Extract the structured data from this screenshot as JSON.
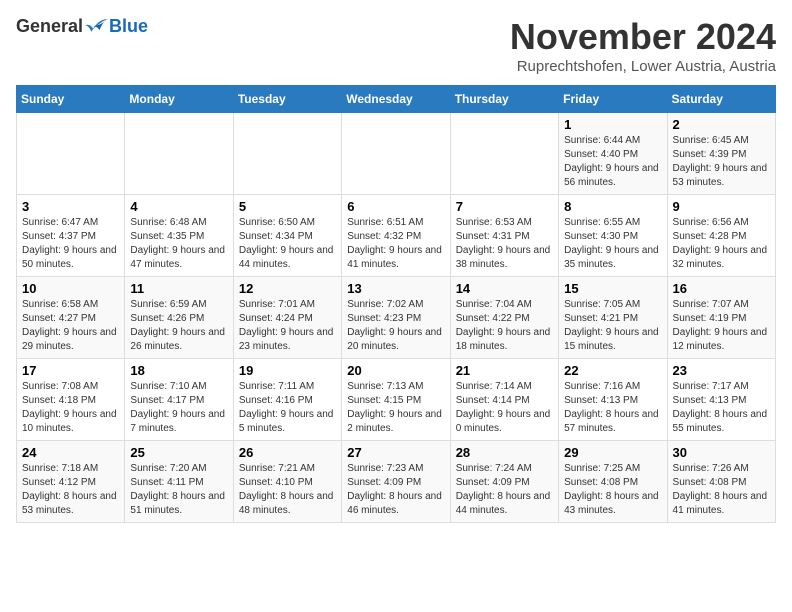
{
  "logo": {
    "general": "General",
    "blue": "Blue"
  },
  "header": {
    "month": "November 2024",
    "location": "Ruprechtshofen, Lower Austria, Austria"
  },
  "weekdays": [
    "Sunday",
    "Monday",
    "Tuesday",
    "Wednesday",
    "Thursday",
    "Friday",
    "Saturday"
  ],
  "weeks": [
    [
      {
        "day": "",
        "info": ""
      },
      {
        "day": "",
        "info": ""
      },
      {
        "day": "",
        "info": ""
      },
      {
        "day": "",
        "info": ""
      },
      {
        "day": "",
        "info": ""
      },
      {
        "day": "1",
        "info": "Sunrise: 6:44 AM\nSunset: 4:40 PM\nDaylight: 9 hours and 56 minutes."
      },
      {
        "day": "2",
        "info": "Sunrise: 6:45 AM\nSunset: 4:39 PM\nDaylight: 9 hours and 53 minutes."
      }
    ],
    [
      {
        "day": "3",
        "info": "Sunrise: 6:47 AM\nSunset: 4:37 PM\nDaylight: 9 hours and 50 minutes."
      },
      {
        "day": "4",
        "info": "Sunrise: 6:48 AM\nSunset: 4:35 PM\nDaylight: 9 hours and 47 minutes."
      },
      {
        "day": "5",
        "info": "Sunrise: 6:50 AM\nSunset: 4:34 PM\nDaylight: 9 hours and 44 minutes."
      },
      {
        "day": "6",
        "info": "Sunrise: 6:51 AM\nSunset: 4:32 PM\nDaylight: 9 hours and 41 minutes."
      },
      {
        "day": "7",
        "info": "Sunrise: 6:53 AM\nSunset: 4:31 PM\nDaylight: 9 hours and 38 minutes."
      },
      {
        "day": "8",
        "info": "Sunrise: 6:55 AM\nSunset: 4:30 PM\nDaylight: 9 hours and 35 minutes."
      },
      {
        "day": "9",
        "info": "Sunrise: 6:56 AM\nSunset: 4:28 PM\nDaylight: 9 hours and 32 minutes."
      }
    ],
    [
      {
        "day": "10",
        "info": "Sunrise: 6:58 AM\nSunset: 4:27 PM\nDaylight: 9 hours and 29 minutes."
      },
      {
        "day": "11",
        "info": "Sunrise: 6:59 AM\nSunset: 4:26 PM\nDaylight: 9 hours and 26 minutes."
      },
      {
        "day": "12",
        "info": "Sunrise: 7:01 AM\nSunset: 4:24 PM\nDaylight: 9 hours and 23 minutes."
      },
      {
        "day": "13",
        "info": "Sunrise: 7:02 AM\nSunset: 4:23 PM\nDaylight: 9 hours and 20 minutes."
      },
      {
        "day": "14",
        "info": "Sunrise: 7:04 AM\nSunset: 4:22 PM\nDaylight: 9 hours and 18 minutes."
      },
      {
        "day": "15",
        "info": "Sunrise: 7:05 AM\nSunset: 4:21 PM\nDaylight: 9 hours and 15 minutes."
      },
      {
        "day": "16",
        "info": "Sunrise: 7:07 AM\nSunset: 4:19 PM\nDaylight: 9 hours and 12 minutes."
      }
    ],
    [
      {
        "day": "17",
        "info": "Sunrise: 7:08 AM\nSunset: 4:18 PM\nDaylight: 9 hours and 10 minutes."
      },
      {
        "day": "18",
        "info": "Sunrise: 7:10 AM\nSunset: 4:17 PM\nDaylight: 9 hours and 7 minutes."
      },
      {
        "day": "19",
        "info": "Sunrise: 7:11 AM\nSunset: 4:16 PM\nDaylight: 9 hours and 5 minutes."
      },
      {
        "day": "20",
        "info": "Sunrise: 7:13 AM\nSunset: 4:15 PM\nDaylight: 9 hours and 2 minutes."
      },
      {
        "day": "21",
        "info": "Sunrise: 7:14 AM\nSunset: 4:14 PM\nDaylight: 9 hours and 0 minutes."
      },
      {
        "day": "22",
        "info": "Sunrise: 7:16 AM\nSunset: 4:13 PM\nDaylight: 8 hours and 57 minutes."
      },
      {
        "day": "23",
        "info": "Sunrise: 7:17 AM\nSunset: 4:13 PM\nDaylight: 8 hours and 55 minutes."
      }
    ],
    [
      {
        "day": "24",
        "info": "Sunrise: 7:18 AM\nSunset: 4:12 PM\nDaylight: 8 hours and 53 minutes."
      },
      {
        "day": "25",
        "info": "Sunrise: 7:20 AM\nSunset: 4:11 PM\nDaylight: 8 hours and 51 minutes."
      },
      {
        "day": "26",
        "info": "Sunrise: 7:21 AM\nSunset: 4:10 PM\nDaylight: 8 hours and 48 minutes."
      },
      {
        "day": "27",
        "info": "Sunrise: 7:23 AM\nSunset: 4:09 PM\nDaylight: 8 hours and 46 minutes."
      },
      {
        "day": "28",
        "info": "Sunrise: 7:24 AM\nSunset: 4:09 PM\nDaylight: 8 hours and 44 minutes."
      },
      {
        "day": "29",
        "info": "Sunrise: 7:25 AM\nSunset: 4:08 PM\nDaylight: 8 hours and 43 minutes."
      },
      {
        "day": "30",
        "info": "Sunrise: 7:26 AM\nSunset: 4:08 PM\nDaylight: 8 hours and 41 minutes."
      }
    ]
  ]
}
